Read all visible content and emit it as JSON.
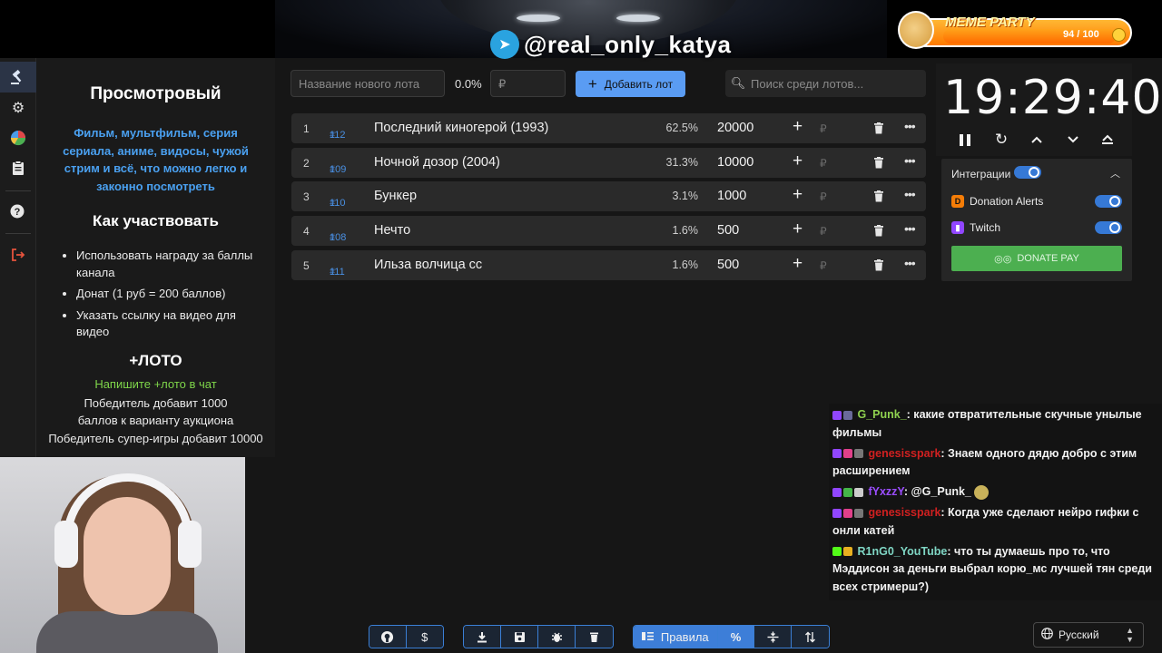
{
  "overlay": {
    "telegram_handle": "@real_only_katya",
    "meme_party": {
      "title": "MEME PARTY",
      "count": "94 / 100",
      "progress": 0.94
    }
  },
  "nav": {
    "items": [
      "auction-icon",
      "settings-icon",
      "stats-icon",
      "clipboard-icon",
      "help-icon",
      "logout-icon"
    ]
  },
  "rules": {
    "title": "Просмотровый",
    "description": "Фильм, мультфильм, серия сериала, аниме, видосы, чужой стрим и всё, что можно легко и законно посмотреть",
    "how_title": "Как участвовать",
    "how_items": [
      "Использовать награду за баллы канала",
      "Донат (1 руб = 200 баллов)",
      "Указать ссылку на видео для видео"
    ],
    "loto_title": "+ЛОТО",
    "loto_hint": "Напишите +лото в чат",
    "loto_text1": "Победитель добавит 1000 баллов к варианту аукциона",
    "loto_text2": "Победитель супер-игры добавит 10000"
  },
  "form": {
    "name_placeholder": "Название нового лота",
    "percent": "0.0%",
    "price_placeholder": "₽",
    "add_label": "Добавить лот",
    "search_placeholder": "Поиск среди лотов..."
  },
  "lots": [
    {
      "num": "1",
      "id": "112",
      "name": "Последний киногерой (1993)",
      "pct": "62.5%",
      "amount": "20000"
    },
    {
      "num": "2",
      "id": "109",
      "name": "Ночной дозор (2004)",
      "pct": "31.3%",
      "amount": "10000"
    },
    {
      "num": "3",
      "id": "110",
      "name": "Бункер",
      "pct": "3.1%",
      "amount": "1000"
    },
    {
      "num": "4",
      "id": "108",
      "name": "Нечто",
      "pct": "1.6%",
      "amount": "500"
    },
    {
      "num": "5",
      "id": "111",
      "name": "Ильза волчица сс",
      "pct": "1.6%",
      "amount": "500"
    }
  ],
  "lot_symbols": {
    "plus": "+",
    "rub": "₽",
    "hash": "#",
    "more": "•••"
  },
  "timer": {
    "value": "19:29:40"
  },
  "integrations": {
    "title": "Интеграции",
    "items": [
      {
        "name": "Donation Alerts",
        "color": "#f57d07"
      },
      {
        "name": "Twitch",
        "color": "#9146ff"
      }
    ],
    "donate_pay": "DONATE PAY"
  },
  "chat": [
    {
      "user": "G_Punk_",
      "color": "#8fd14f",
      "text": ": какие отвратительные скучные унылые фильмы"
    },
    {
      "user": "genesisspark",
      "color": "#d02020",
      "text": ": Знаем одного дядю добро с этим расширением"
    },
    {
      "user": "fYxzzY",
      "color": "#9b4dff",
      "text": ": @G_Punk_"
    },
    {
      "user": "genesisspark",
      "color": "#d02020",
      "text": ": Когда уже сделают нейро гифки с онли катей"
    },
    {
      "user": "R1nG0_YouTube",
      "color": "#7fd6c4",
      "text": ": что ты думаешь про то, что Мэддисон за деньги выбрал корю_мс лучшей тян среди всех стримерш?)"
    }
  ],
  "bottom": {
    "rules_label": "Правила",
    "language": "Русский",
    "group1": [
      "github-icon",
      "dollar-icon"
    ],
    "group2": [
      "download-icon",
      "save-icon",
      "bug-icon",
      "delete-icon"
    ],
    "group3": [
      "rules-icon",
      "percent-icon",
      "split-icon",
      "sort-icon"
    ]
  }
}
